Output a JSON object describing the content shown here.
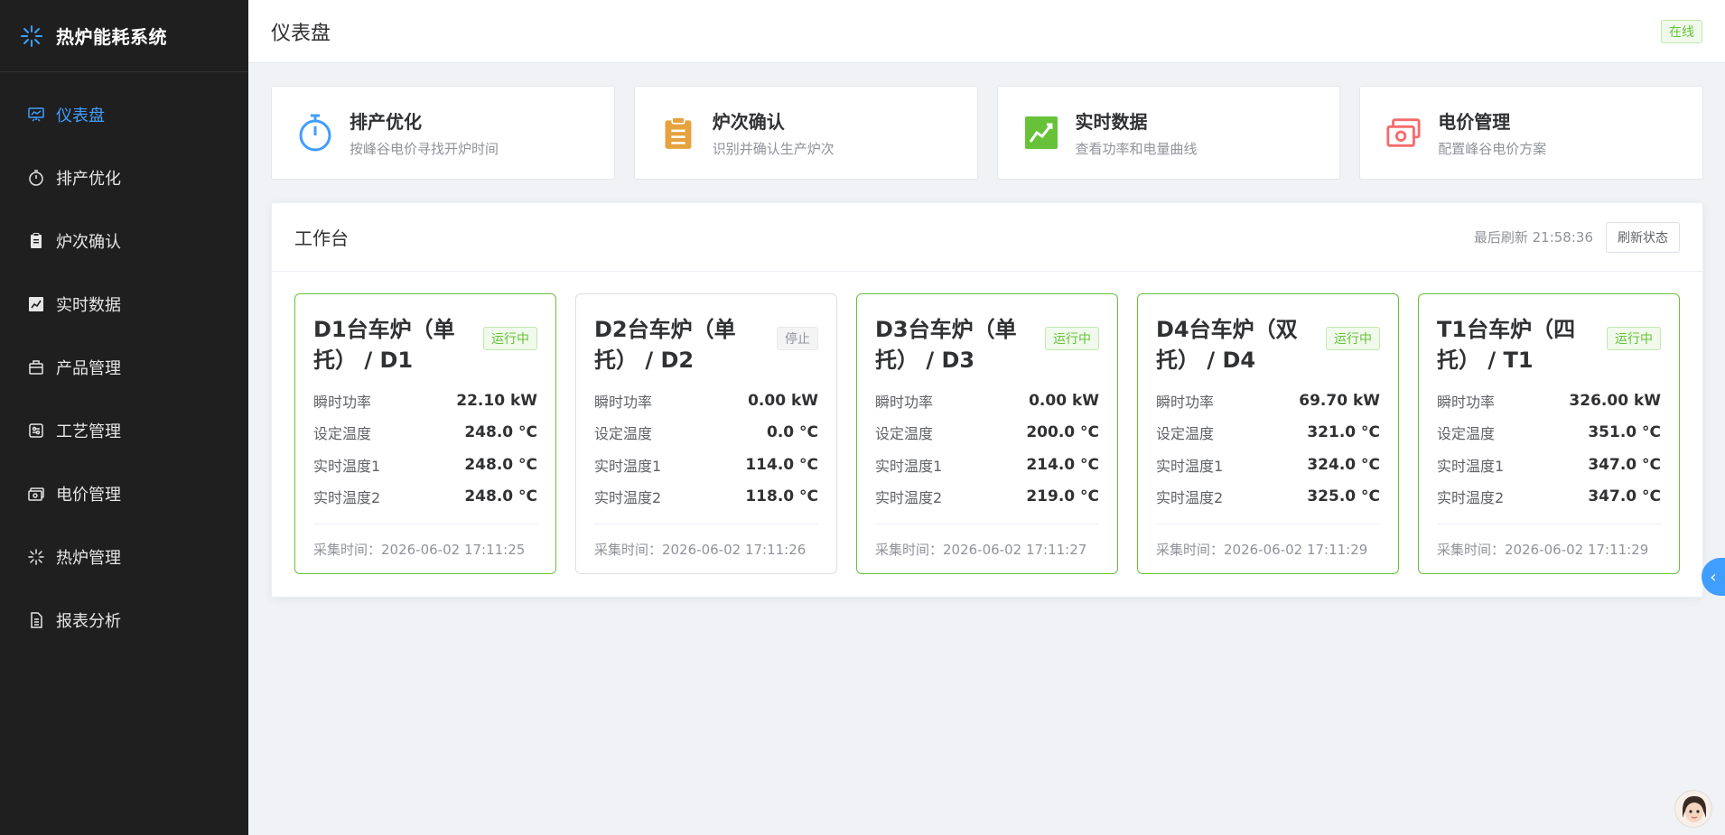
{
  "app": {
    "title": "热炉能耗系统"
  },
  "sidebar": {
    "items": [
      {
        "label": "仪表盘",
        "icon": "presentation-board-icon",
        "active": true
      },
      {
        "label": "排产优化",
        "icon": "stopwatch-icon"
      },
      {
        "label": "炉次确认",
        "icon": "clipboard-icon"
      },
      {
        "label": "实时数据",
        "icon": "trend-chart-icon"
      },
      {
        "label": "产品管理",
        "icon": "box-icon"
      },
      {
        "label": "工艺管理",
        "icon": "process-settings-icon"
      },
      {
        "label": "电价管理",
        "icon": "money-icon"
      },
      {
        "label": "热炉管理",
        "icon": "burst-icon"
      },
      {
        "label": "报表分析",
        "icon": "document-icon"
      }
    ]
  },
  "header": {
    "title": "仪表盘",
    "status": "在线"
  },
  "shortcuts": [
    {
      "title": "排产优化",
      "subtitle": "按峰谷电价寻找开炉时间",
      "icon": "stopwatch-icon",
      "color": "#409eff"
    },
    {
      "title": "炉次确认",
      "subtitle": "识别并确认生产炉次",
      "icon": "clipboard-icon",
      "color": "#e6a23c"
    },
    {
      "title": "实时数据",
      "subtitle": "查看功率和电量曲线",
      "icon": "trend-chart-icon",
      "color": "#67c23a"
    },
    {
      "title": "电价管理",
      "subtitle": "配置峰谷电价方案",
      "icon": "money-icon",
      "color": "#f56c6c"
    }
  ],
  "workbench": {
    "title": "工作台",
    "last_refresh": "最后刷新 21:58:36",
    "refresh_button": "刷新状态"
  },
  "furnaces": [
    {
      "name": "D1台车炉（单托） / D1",
      "status": "运行中",
      "running": true,
      "power": "22.10 kW",
      "set_temp": "248.0 °C",
      "temp1": "248.0 °C",
      "temp2": "248.0 °C",
      "time": "采集时间：2026-06-02 17:11:25"
    },
    {
      "name": "D2台车炉（单托） / D2",
      "status": "停止",
      "running": false,
      "power": "0.00 kW",
      "set_temp": "0.0 °C",
      "temp1": "114.0 °C",
      "temp2": "118.0 °C",
      "time": "采集时间：2026-06-02 17:11:26"
    },
    {
      "name": "D3台车炉（单托） / D3",
      "status": "运行中",
      "running": true,
      "power": "0.00 kW",
      "set_temp": "200.0 °C",
      "temp1": "214.0 °C",
      "temp2": "219.0 °C",
      "time": "采集时间：2026-06-02 17:11:27"
    },
    {
      "name": "D4台车炉（双托） / D4",
      "status": "运行中",
      "running": true,
      "power": "69.70 kW",
      "set_temp": "321.0 °C",
      "temp1": "324.0 °C",
      "temp2": "325.0 °C",
      "time": "采集时间：2026-06-02 17:11:29"
    },
    {
      "name": "T1台车炉（四托） / T1",
      "status": "运行中",
      "running": true,
      "power": "326.00 kW",
      "set_temp": "351.0 °C",
      "temp1": "347.0 °C",
      "temp2": "347.0 °C",
      "time": "采集时间：2026-06-02 17:11:29"
    }
  ],
  "metric_labels": {
    "power": "瞬时功率",
    "set_temp": "设定温度",
    "temp1": "实时温度1",
    "temp2": "实时温度2"
  },
  "colors": {
    "sidebar_bg": "#1f1f1f",
    "accent": "#409eff",
    "running": "#67c23a",
    "stopped": "#909399"
  }
}
